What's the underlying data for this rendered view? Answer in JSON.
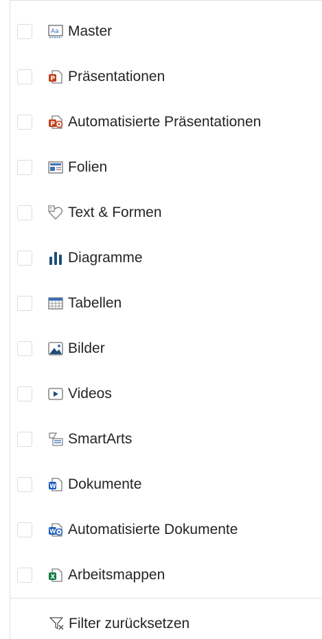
{
  "filter": {
    "items": [
      {
        "label": "Master",
        "icon": "master-icon"
      },
      {
        "label": "Präsentationen",
        "icon": "powerpoint-icon"
      },
      {
        "label": "Automatisierte Präsentationen",
        "icon": "automated-powerpoint-icon"
      },
      {
        "label": "Folien",
        "icon": "slide-icon"
      },
      {
        "label": "Text & Formen",
        "icon": "text-shapes-icon"
      },
      {
        "label": "Diagramme",
        "icon": "chart-icon"
      },
      {
        "label": "Tabellen",
        "icon": "table-icon"
      },
      {
        "label": "Bilder",
        "icon": "image-icon"
      },
      {
        "label": "Videos",
        "icon": "video-icon"
      },
      {
        "label": "SmartArts",
        "icon": "smartart-icon"
      },
      {
        "label": "Dokumente",
        "icon": "word-icon"
      },
      {
        "label": "Automatisierte Dokumente",
        "icon": "automated-word-icon"
      },
      {
        "label": "Arbeitsmappen",
        "icon": "excel-icon"
      }
    ],
    "reset_label": "Filter zurücksetzen",
    "reset_icon": "filter-reset-icon"
  },
  "colors": {
    "powerpoint": "#c43e1c",
    "word": "#185abd",
    "excel": "#107c41",
    "chart": "#1f4e79",
    "text": "#252423",
    "border": "#e1dfdd"
  }
}
